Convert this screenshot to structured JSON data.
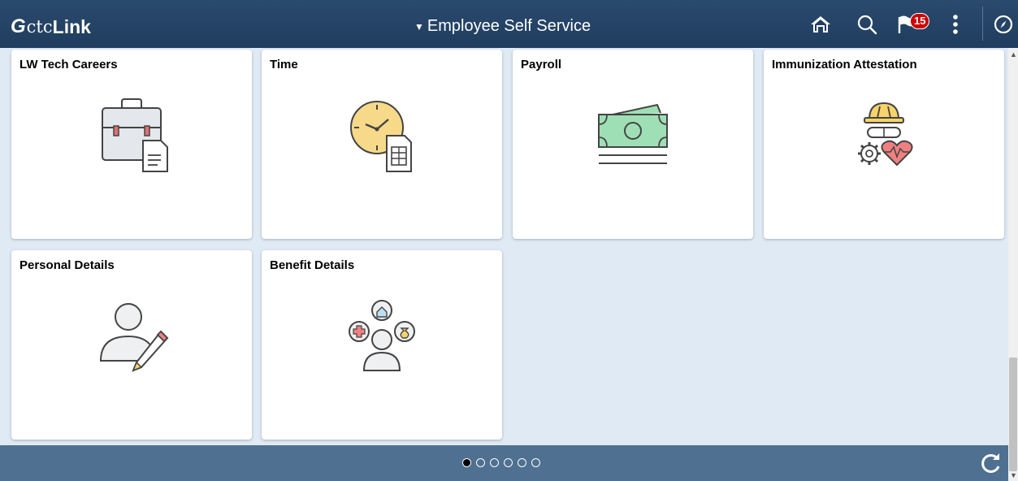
{
  "header": {
    "logo_mark": "G",
    "logo_ctc": "ctc",
    "logo_link": "Link",
    "title_caret": "▼",
    "title": "Employee Self Service",
    "notification_count": "15",
    "icons": [
      "home-icon",
      "search-icon",
      "notification-flag-icon",
      "actions-menu-icon",
      "navbar-compass-icon"
    ]
  },
  "tiles": [
    {
      "title": "LW Tech Careers",
      "icon": "briefcase-document-icon"
    },
    {
      "title": "Time",
      "icon": "clock-timesheet-icon"
    },
    {
      "title": "Payroll",
      "icon": "money-bill-icon"
    },
    {
      "title": "Immunization Attestation",
      "icon": "hardhat-goggles-gear-heart-icon"
    },
    {
      "title": "Personal Details",
      "icon": "person-pencil-icon"
    },
    {
      "title": "Benefit Details",
      "icon": "person-benefits-icon"
    }
  ],
  "footer": {
    "page_indicator_count": 6,
    "active_page": 1
  },
  "colors": {
    "header_bg": "#1f3d5e",
    "page_bg": "#dfeaf4",
    "footer_bg": "#4f7090",
    "badge": "#cc0000",
    "clock_yellow": "#f7d98a",
    "money_green": "#9fdfb5",
    "hardhat_yellow": "#f7d36b",
    "heart_red": "#f08080"
  }
}
